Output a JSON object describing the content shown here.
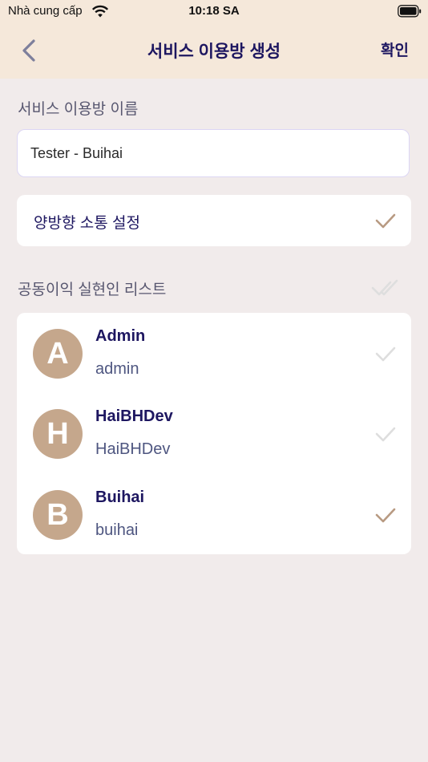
{
  "status_bar": {
    "carrier": "Nhà cung cấp",
    "time": "10:18 SA"
  },
  "nav": {
    "title": "서비스 이용방 생성",
    "confirm_label": "확인"
  },
  "room_name": {
    "label": "서비스 이용방 이름",
    "value": "Tester - Buihai"
  },
  "two_way": {
    "label": "양방향 소통 설정",
    "checked": true
  },
  "members_section": {
    "label": "공동이익 실현인 리스트"
  },
  "members": [
    {
      "initial": "A",
      "name": "Admin",
      "id": "admin",
      "checked": false
    },
    {
      "initial": "H",
      "name": "HaiBHDev",
      "id": "HaiBHDev",
      "checked": false
    },
    {
      "initial": "B",
      "name": "Buihai",
      "id": "buihai",
      "checked": true
    }
  ],
  "colors": {
    "header_bg": "#f5e8da",
    "page_bg": "#f1ebeb",
    "title": "#1d1660",
    "avatar": "#c5a78c",
    "check_active": "#b89a82",
    "check_inactive": "#dedede"
  }
}
